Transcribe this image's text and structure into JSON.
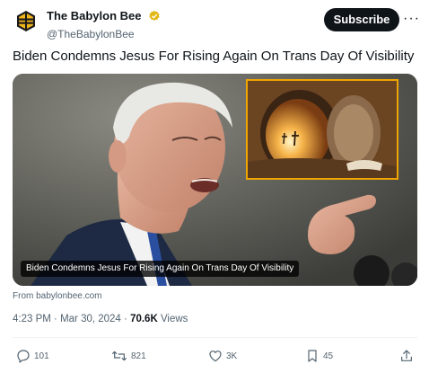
{
  "author": {
    "display_name": "The Babylon Bee",
    "handle": "@TheBabylonBee",
    "verified": true,
    "badge_color": "#e2b719"
  },
  "header": {
    "subscribe_label": "Subscribe",
    "more_label": "···"
  },
  "tweet": {
    "text": "Biden Condemns Jesus For Rising Again On Trans Day Of Visibility"
  },
  "media": {
    "caption": "Biden Condemns Jesus For Rising Again On Trans Day Of Visibility",
    "inset_border_color": "#f0a500"
  },
  "link": {
    "source": "From babylonbee.com"
  },
  "meta": {
    "time": "4:23 PM",
    "separator_1": " · ",
    "date": "Mar 30, 2024",
    "separator_2": " · ",
    "views_count": "70.6K",
    "views_label": " Views"
  },
  "actions": {
    "replies": "101",
    "reposts": "821",
    "likes": "3K",
    "bookmarks": "45"
  }
}
